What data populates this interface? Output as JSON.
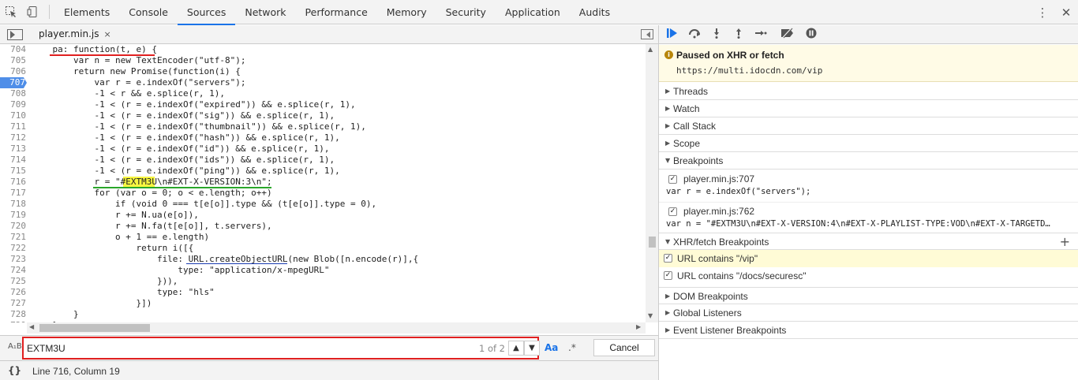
{
  "toolbar": {
    "tabs": [
      "Elements",
      "Console",
      "Sources",
      "Network",
      "Performance",
      "Memory",
      "Security",
      "Application",
      "Audits"
    ],
    "active_tab": "Sources"
  },
  "file_tab": {
    "name": "player.min.js",
    "close": "×"
  },
  "code": {
    "lines": [
      {
        "n": "704",
        "text": "    pa: function(t, e) {"
      },
      {
        "n": "705",
        "text": "        var n = new TextEncoder(\"utf-8\");"
      },
      {
        "n": "706",
        "text": "        return new Promise(function(i) {"
      },
      {
        "n": "707",
        "text": "            var r = e.indexOf(\"servers\");",
        "breakpoint": true
      },
      {
        "n": "708",
        "text": "            -1 < r && e.splice(r, 1),"
      },
      {
        "n": "709",
        "text": "            -1 < (r = e.indexOf(\"expired\")) && e.splice(r, 1),"
      },
      {
        "n": "710",
        "text": "            -1 < (r = e.indexOf(\"sig\")) && e.splice(r, 1),"
      },
      {
        "n": "711",
        "text": "            -1 < (r = e.indexOf(\"thumbnail\")) && e.splice(r, 1),"
      },
      {
        "n": "712",
        "text": "            -1 < (r = e.indexOf(\"hash\")) && e.splice(r, 1),"
      },
      {
        "n": "713",
        "text": "            -1 < (r = e.indexOf(\"id\")) && e.splice(r, 1),"
      },
      {
        "n": "714",
        "text": "            -1 < (r = e.indexOf(\"ids\")) && e.splice(r, 1),"
      },
      {
        "n": "715",
        "text": "            -1 < (r = e.indexOf(\"ping\")) && e.splice(r, 1),"
      },
      {
        "n": "716",
        "text": "            r = \"#EXTM3U\\n#EXT-X-VERSION:3\\n\";"
      },
      {
        "n": "717",
        "text": "            for (var o = 0; o < e.length; o++)"
      },
      {
        "n": "718",
        "text": "                if (void 0 === t[e[o]].type && (t[e[o]].type = 0),"
      },
      {
        "n": "719",
        "text": "                r += N.ua(e[o]),"
      },
      {
        "n": "720",
        "text": "                r += N.fa(t[e[o]], t.servers),"
      },
      {
        "n": "721",
        "text": "                o + 1 == e.length)"
      },
      {
        "n": "722",
        "text": "                    return i([{"
      },
      {
        "n": "723",
        "text": "                        file: URL.createObjectURL(new Blob([n.encode(r)],{"
      },
      {
        "n": "724",
        "text": "                            type: \"application/x-mpegURL\""
      },
      {
        "n": "725",
        "text": "                        })),"
      },
      {
        "n": "726",
        "text": "                        type: \"hls\""
      },
      {
        "n": "727",
        "text": "                    }])"
      },
      {
        "n": "728",
        "text": "        }"
      },
      {
        "n": "729",
        "text": "    }"
      }
    ]
  },
  "search": {
    "value": "EXTM3U",
    "count": "1 of 2",
    "case_label": "Aa",
    "regex_label": ".*",
    "cancel_label": "Cancel",
    "ab_label": "A₁B"
  },
  "status": {
    "braces": "{}",
    "position": "Line 716, Column 19"
  },
  "debugger": {
    "paused_title": "Paused on XHR or fetch",
    "paused_url": "https://multi.idocdn.com/vip",
    "sections": {
      "threads": "Threads",
      "watch": "Watch",
      "call_stack": "Call Stack",
      "scope": "Scope",
      "breakpoints": "Breakpoints",
      "xhr": "XHR/fetch Breakpoints",
      "dom": "DOM Breakpoints",
      "global": "Global Listeners",
      "event": "Event Listener Breakpoints"
    },
    "breakpoints": [
      {
        "file": "player.min.js:707",
        "code": "var r = e.indexOf(\"servers\");"
      },
      {
        "file": "player.min.js:762",
        "code": "var n = \"#EXTM3U\\n#EXT-X-VERSION:4\\n#EXT-X-PLAYLIST-TYPE:VOD\\n#EXT-X-TARGETD…"
      }
    ],
    "xhr_breakpoints": [
      {
        "label": "URL contains \"/vip\""
      },
      {
        "label": "URL contains \"/docs/securesc\""
      }
    ]
  },
  "colors": {
    "accent": "#1a73e8",
    "breakpoint": "#4f8ee8",
    "search_border": "#e02020",
    "paused_bg": "#fffbe6"
  }
}
